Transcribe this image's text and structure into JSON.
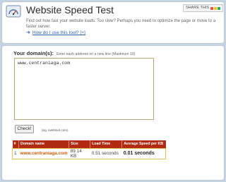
{
  "header": {
    "title": "Website Speed Test",
    "share_label": "SHARE THIS",
    "description": "Find out how fast your website loads. Too slow? Perhaps you need to optimize the page or move to a faster server.",
    "help_link": "How do I use this tool? [+]"
  },
  "form": {
    "label": "Your domain(s):",
    "hint": "Enter each address on a new line (Maximum 10)",
    "textarea_value": "www.centraniaga.com",
    "check_button": "Check!",
    "example": "(eg. iwebtool.com)"
  },
  "results": {
    "columns": [
      "#",
      "Domain name",
      "Size",
      "Load Time",
      "Average Speed per KB"
    ],
    "rows": [
      {
        "index": "1",
        "domain": "www.centraniaga.com",
        "size": "89.14 KB",
        "load_time": "0.51 seconds",
        "avg_speed": "0.01 seconds"
      }
    ]
  },
  "colors": {
    "background": "#c7d4e1",
    "table_header": "#b12a12",
    "link": "#2a5db0",
    "domain_text": "#c85a00"
  }
}
